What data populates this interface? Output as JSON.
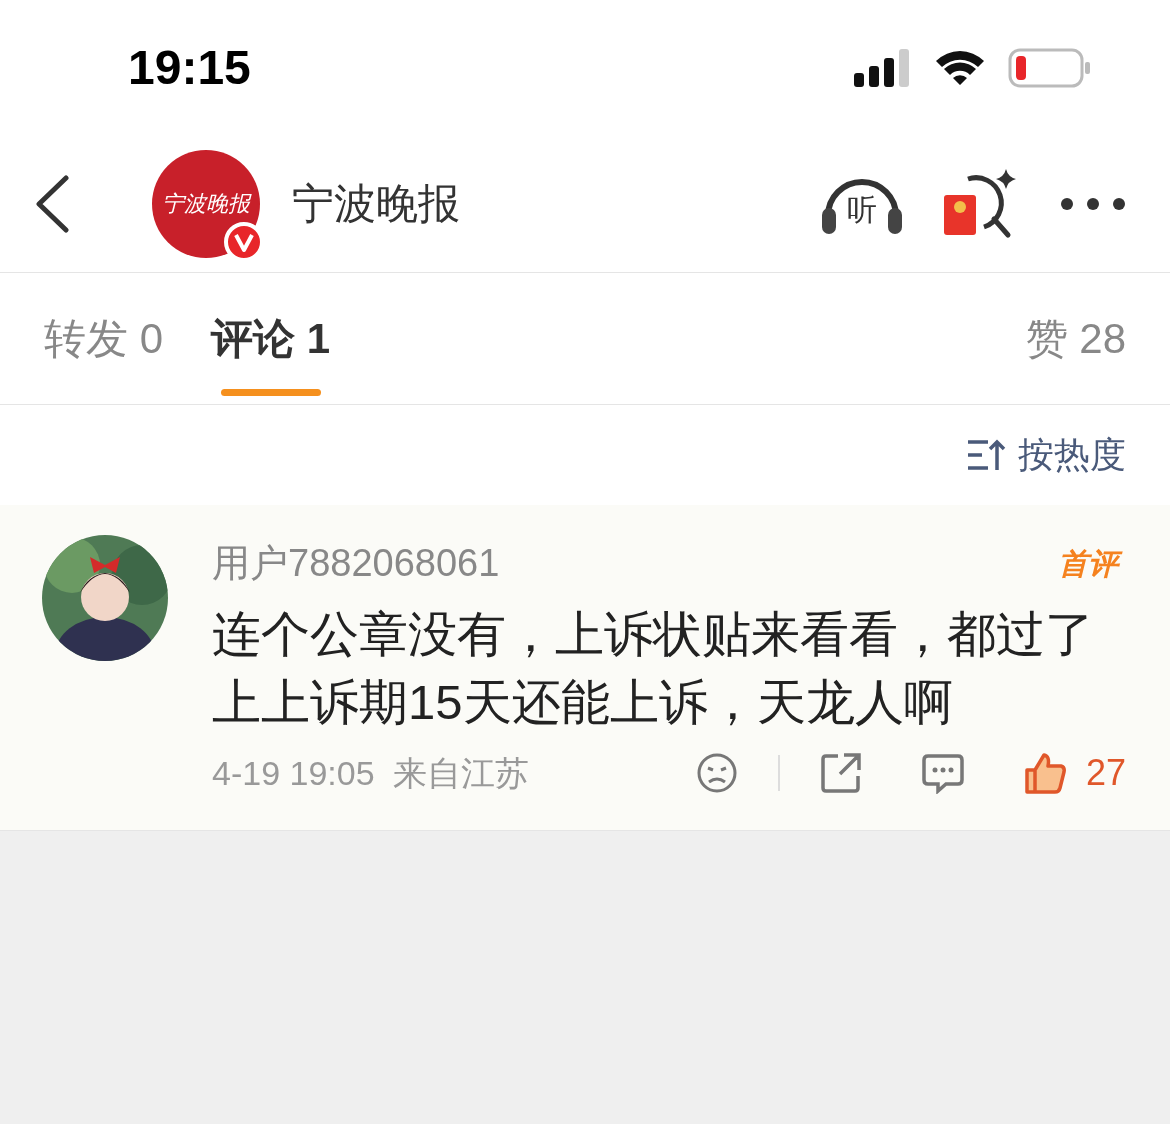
{
  "status_bar": {
    "time": "19:15"
  },
  "header": {
    "account_name": "宁波晚报",
    "logo_text": "宁波晚报",
    "verified": true,
    "listen_label": "听"
  },
  "tabs": [
    {
      "label": "转发",
      "count": "0",
      "selected": false
    },
    {
      "label": "评论",
      "count": "1",
      "selected": true
    }
  ],
  "likes": {
    "label": "赞",
    "count": "28"
  },
  "sort": {
    "label": "按热度"
  },
  "comments": [
    {
      "user": "用户7882068061",
      "badge": "首评",
      "text": "连个公章没有，上诉状贴来看看，都过了上上诉期15天还能上诉，天龙人啊",
      "time": "4-19 19:05",
      "location": "来自江苏",
      "likes": "27",
      "liked": true
    }
  ]
}
